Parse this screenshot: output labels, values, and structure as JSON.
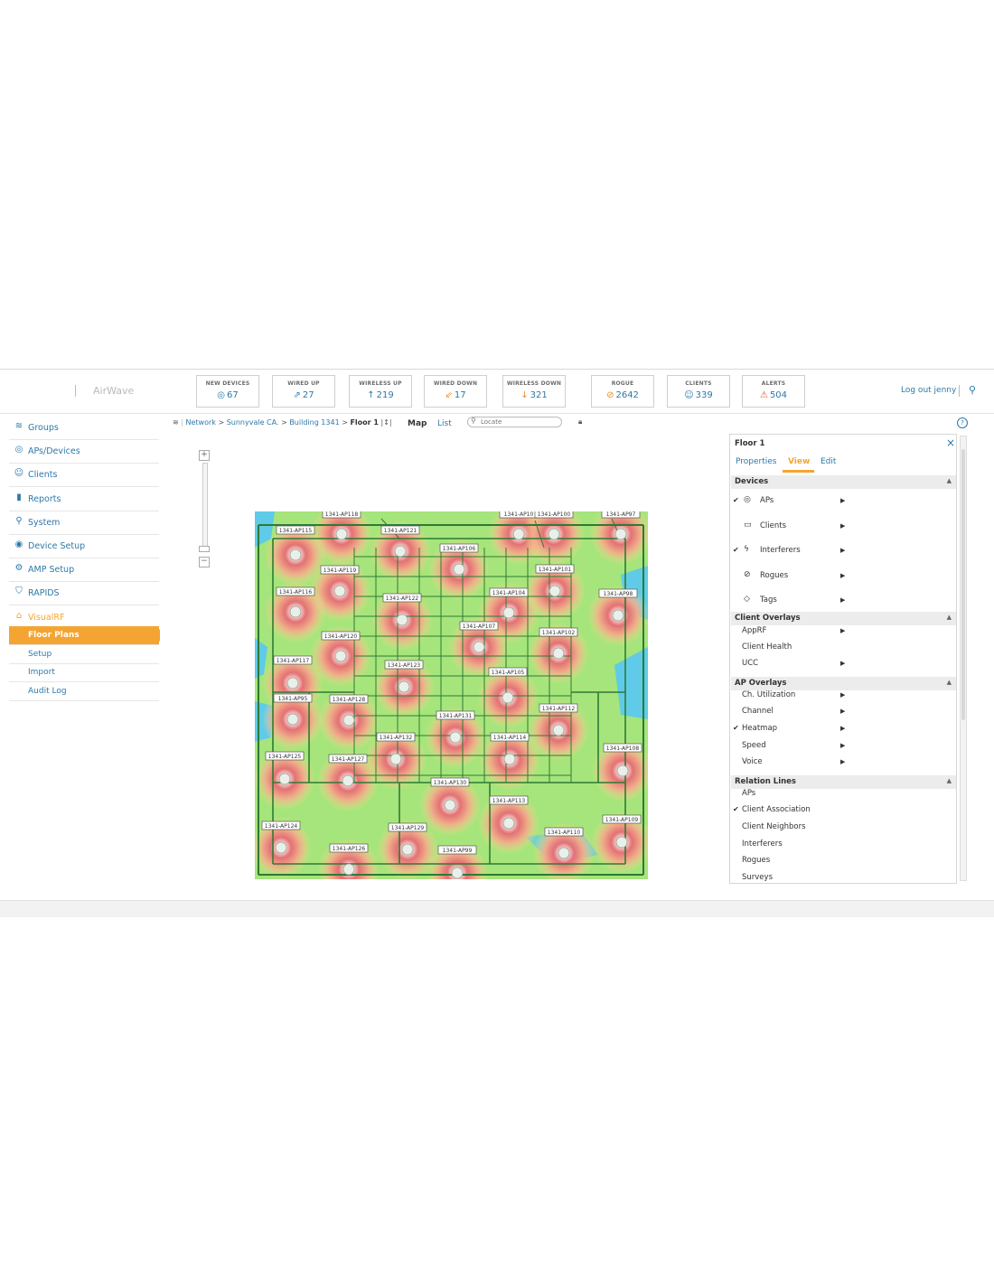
{
  "brand": "AirWave",
  "stats": [
    {
      "label": "NEW DEVICES",
      "value": "67",
      "icon": "◎",
      "icon_name": "new-devices-icon",
      "icon_color": "#2c79a8"
    },
    {
      "label": "WIRED UP",
      "value": "27",
      "icon": "⇗",
      "icon_name": "wired-up-icon",
      "icon_color": "#2c79a8"
    },
    {
      "label": "WIRELESS UP",
      "value": "219",
      "icon": "↑",
      "icon_name": "wireless-up-icon",
      "icon_color": "#2c79a8"
    },
    {
      "label": "WIRED DOWN",
      "value": "17",
      "icon": "⇙",
      "icon_name": "wired-down-icon",
      "icon_color": "#f08a24"
    },
    {
      "label": "WIRELESS DOWN",
      "value": "321",
      "icon": "↓",
      "icon_name": "wireless-down-icon",
      "icon_color": "#f08a24"
    },
    {
      "label": "ROGUE",
      "value": "2642",
      "icon": "⊘",
      "icon_name": "rogue-icon",
      "icon_color": "#f08a24"
    },
    {
      "label": "CLIENTS",
      "value": "339",
      "icon": "☺",
      "icon_name": "clients-icon",
      "icon_color": "#2c79a8"
    },
    {
      "label": "ALERTS",
      "value": "504",
      "icon": "⚠",
      "icon_name": "alerts-icon",
      "icon_color": "#e5532a"
    }
  ],
  "header": {
    "logout": "Log out jenny"
  },
  "sidebar": {
    "items": [
      {
        "label": "Groups",
        "icon": "≋",
        "icon_name": "groups-icon"
      },
      {
        "label": "APs/Devices",
        "icon": "◎",
        "icon_name": "aps-devices-icon"
      },
      {
        "label": "Clients",
        "icon": "☺",
        "icon_name": "clients-icon"
      },
      {
        "label": "Reports",
        "icon": "▮",
        "icon_name": "reports-icon"
      },
      {
        "label": "System",
        "icon": "⚲",
        "icon_name": "system-icon"
      },
      {
        "label": "Device Setup",
        "icon": "◉",
        "icon_name": "device-setup-icon"
      },
      {
        "label": "AMP Setup",
        "icon": "⚙",
        "icon_name": "amp-setup-icon"
      },
      {
        "label": "RAPIDS",
        "icon": "⛉",
        "icon_name": "rapids-icon"
      },
      {
        "label": "VisualRF",
        "icon": "⌂",
        "icon_name": "visualrf-icon"
      }
    ],
    "subitems": [
      {
        "label": "Floor Plans",
        "active": true
      },
      {
        "label": "Setup"
      },
      {
        "label": "Import"
      },
      {
        "label": "Audit Log"
      }
    ]
  },
  "breadcrumb": {
    "network": "Network",
    "campus": "Sunnyvale CA.",
    "building": "Building 1341",
    "floor": "Floor 1",
    "sep": ">"
  },
  "toolbar": {
    "map": "Map",
    "list": "List",
    "locate_placeholder": "Locate"
  },
  "panel": {
    "title": "Floor 1",
    "tabs": [
      "Properties",
      "View",
      "Edit"
    ],
    "active_tab": "View",
    "sections": [
      {
        "title": "Devices",
        "rows": [
          {
            "label": "APs",
            "checked": true,
            "icon": "◎",
            "icon_name": "aps-icon",
            "arrow": true
          },
          {
            "label": "Clients",
            "checked": false,
            "icon": "▭",
            "icon_name": "clients-monitor-icon",
            "arrow": true
          },
          {
            "label": "Interferers",
            "checked": true,
            "icon": "ϟ",
            "icon_name": "interferers-icon",
            "arrow": true
          },
          {
            "label": "Rogues",
            "checked": false,
            "icon": "⊘",
            "icon_name": "rogues-icon",
            "arrow": true
          },
          {
            "label": "Tags",
            "checked": false,
            "icon": "◇",
            "icon_name": "tags-icon",
            "arrow": true
          }
        ]
      },
      {
        "title": "Client Overlays",
        "rows": [
          {
            "label": "AppRF",
            "checked": false,
            "arrow": true
          },
          {
            "label": "Client Health",
            "checked": false,
            "arrow": false
          },
          {
            "label": "UCC",
            "checked": false,
            "arrow": true
          }
        ]
      },
      {
        "title": "AP Overlays",
        "rows": [
          {
            "label": "Ch. Utilization",
            "checked": false,
            "arrow": true
          },
          {
            "label": "Channel",
            "checked": false,
            "arrow": true
          },
          {
            "label": "Heatmap",
            "checked": true,
            "arrow": true
          },
          {
            "label": "Speed",
            "checked": false,
            "arrow": true
          },
          {
            "label": "Voice",
            "checked": false,
            "arrow": true
          }
        ]
      },
      {
        "title": "Relation Lines",
        "rows": [
          {
            "label": "APs",
            "checked": false,
            "arrow": false
          },
          {
            "label": "Client Association",
            "checked": true,
            "arrow": false
          },
          {
            "label": "Client Neighbors",
            "checked": false,
            "arrow": false
          },
          {
            "label": "Interferers",
            "checked": false,
            "arrow": false
          },
          {
            "label": "Rogues",
            "checked": false,
            "arrow": false
          },
          {
            "label": "Surveys",
            "checked": false,
            "arrow": false
          }
        ]
      }
    ]
  },
  "floorplan": {
    "access_points": [
      "1341-AP118",
      "1341-AP10",
      "1341-AP100",
      "1341-AP97",
      "1341-AP115",
      "1341-AP121",
      "1341-AP106",
      "1341-AP119",
      "1341-AP101",
      "1341-AP116",
      "1341-AP122",
      "1341-AP104",
      "1341-AP98",
      "1341-AP107",
      "1341-AP120",
      "1341-AP102",
      "1341-AP117",
      "1341-AP123",
      "1341-AP105",
      "1341-AP95",
      "1341-AP128",
      "1341-AP131",
      "1341-AP112",
      "1341-AP132",
      "1341-AP114",
      "1341-AP108",
      "1341-AP125",
      "1341-AP127",
      "1341-AP130",
      "1341-AP113",
      "1341-AP124",
      "1341-AP129",
      "1341-AP110",
      "1341-AP109",
      "1341-AP126",
      "1341-AP99"
    ]
  },
  "colors": {
    "accent": "#f4a531",
    "link": "#2c79a8",
    "heat_green": "#a8e87a",
    "heat_yellow": "#f7d98a",
    "heat_red": "#e8707a",
    "water_blue": "#56c8e6"
  }
}
